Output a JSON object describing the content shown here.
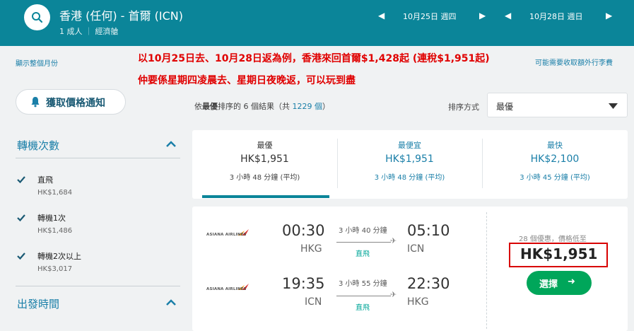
{
  "header": {
    "route": "香港 (任何) - 首爾 (ICN)",
    "travellers": "1 成人",
    "cabin": "經濟艙",
    "depart_date": "10月25日 週四",
    "return_date": "10月28日 週日"
  },
  "left": {
    "month_link": "顯示整個月份",
    "price_alert": "獲取價格通知",
    "stops_title": "轉機次數",
    "departure_title": "出發時間",
    "filters": [
      {
        "label": "直飛",
        "price": "HK$1,684"
      },
      {
        "label": "轉機1次",
        "price": "HK$1,486"
      },
      {
        "label": "轉機2次以上",
        "price": "HK$3,017"
      }
    ]
  },
  "annotation": {
    "line1": "以10月25日去、10月28日返為例，香港來回首爾$1,428起 (連稅$1,951起)",
    "line2": "仲要係星期四凌晨去、星期日夜晚返，可以玩到盡",
    "bag_note": "可能需要收取額外行李費"
  },
  "sort": {
    "prefix": "依",
    "bold": "最優",
    "middle": "排序的 6 個結果（共",
    "total": "1229 個",
    "suffix": "）",
    "label": "排序方式",
    "selected": "最優"
  },
  "tabs": [
    {
      "title": "最優",
      "price": "HK$1,951",
      "duration": "3 小時 48 分鐘 (平均)"
    },
    {
      "title": "最便宜",
      "price": "HK$1,951",
      "duration": "3 小時 48 分鐘 (平均)"
    },
    {
      "title": "最快",
      "price": "HK$2,100",
      "duration": "3 小時 45 分鐘 (平均)"
    }
  ],
  "result": {
    "airline": "ASIANA AIRLINES",
    "outbound": {
      "depart_time": "00:30",
      "depart_code": "HKG",
      "duration": "3 小時 40 分鐘",
      "stops": "直飛",
      "arrive_time": "05:10",
      "arrive_code": "ICN"
    },
    "inbound": {
      "depart_time": "19:35",
      "depart_code": "ICN",
      "duration": "3 小時 55 分鐘",
      "stops": "直飛",
      "arrive_time": "22:30",
      "arrive_code": "HKG"
    },
    "deals": "28 個優惠，價格低至",
    "price": "HK$1,951",
    "select": "選擇"
  },
  "colors": {
    "brand": "#0b8599",
    "link": "#1a7fa8",
    "accent_green": "#00a65a",
    "annotation_red": "#e00000"
  }
}
